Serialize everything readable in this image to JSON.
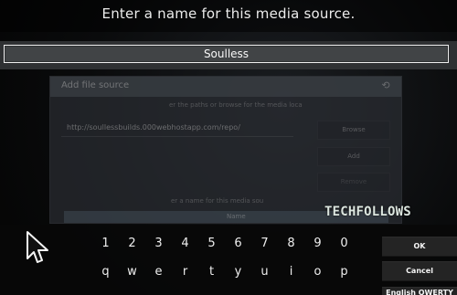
{
  "dialog": {
    "title": "Enter a name for this media source.",
    "input_value": "Soulless"
  },
  "background_dialog": {
    "title": "Add file source",
    "instruction": "er the paths or browse for the media loca",
    "path_value": "http://soullessbuilds.000webhostapp.com/repo/",
    "buttons": {
      "browse": "Browse",
      "add": "Add",
      "remove": "Remove"
    },
    "name_label": "er a name for this media sou",
    "name_value": "Name",
    "icons": {
      "back": "back-icon"
    }
  },
  "watermark": "TECHFOLLOWS",
  "keyboard": {
    "numbers": [
      "1",
      "2",
      "3",
      "4",
      "5",
      "6",
      "7",
      "8",
      "9",
      "0"
    ],
    "letters": [
      "q",
      "w",
      "e",
      "r",
      "t",
      "y",
      "u",
      "i",
      "o",
      "p"
    ],
    "buttons": {
      "ok": "OK",
      "cancel": "Cancel",
      "layout": "English QWERTY"
    }
  },
  "icons": {
    "pointer": "mouse-pointer-icon"
  },
  "colors": {
    "input_border": "#efefef",
    "keyboard_bg": "#080808",
    "side_button_bg": "#242424",
    "watermark": "#dce6df"
  }
}
